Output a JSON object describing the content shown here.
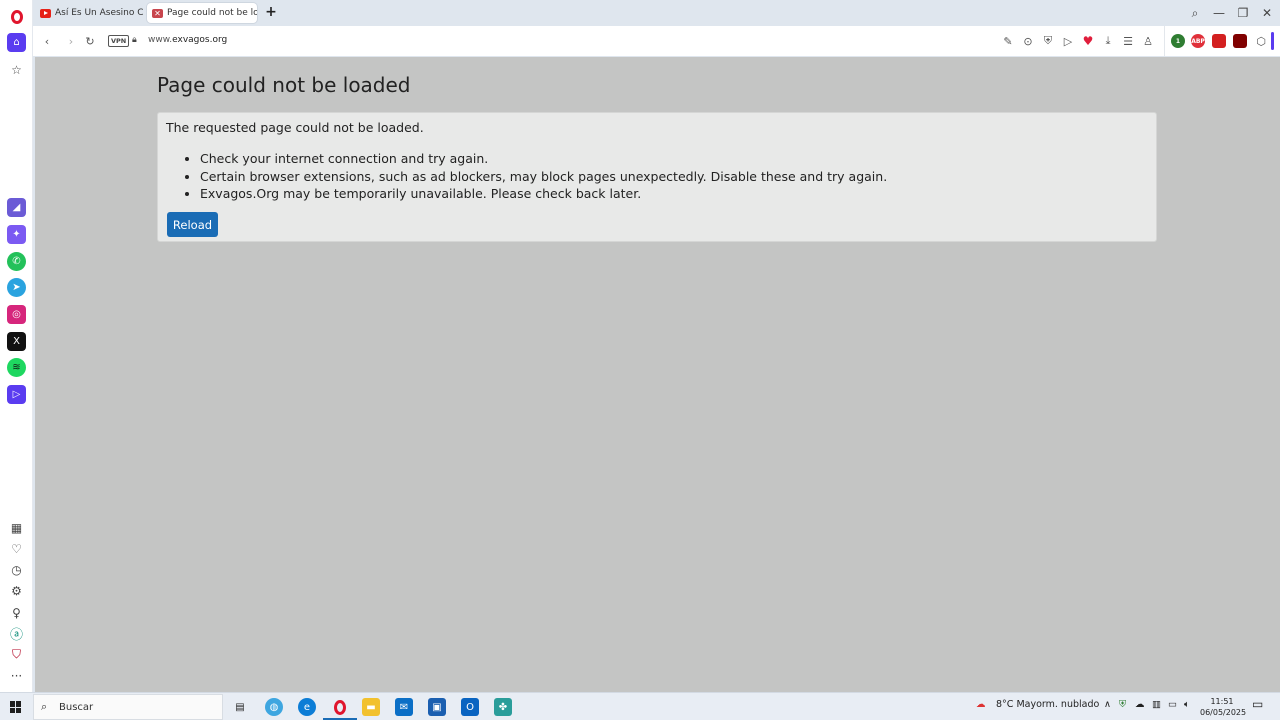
{
  "browser": {
    "tabs": [
      {
        "label": "Así Es Un Asesino Con Un",
        "favicon": "youtube-icon",
        "active": false
      },
      {
        "label": "Page could not be loaded",
        "favicon": "error-icon",
        "active": true
      }
    ],
    "new_tab_symbol": "+",
    "address": {
      "vpn_label": "VPN",
      "url_prefix": "www.",
      "url_domain": "exvagos.org"
    },
    "extensions": [
      {
        "name": "extension-badge-1",
        "badge": "1",
        "color": "#2f7d32"
      },
      {
        "name": "adblock-plus-extension",
        "badge": "ABP",
        "color": "#e0303a"
      },
      {
        "name": "extension-red",
        "badge": "",
        "color": "#d32020"
      },
      {
        "name": "ublock-origin-extension",
        "badge": "",
        "color": "#800000"
      }
    ]
  },
  "error_page": {
    "title": "Page could not be loaded",
    "message": "The requested page could not be loaded.",
    "bullets": [
      "Check your internet connection and try again.",
      "Certain browser extensions, such as ad blockers, may block pages unexpectedly. Disable these and try again.",
      "Exvagos.Org may be temporarily unavailable. Please check back later."
    ],
    "reload_label": "Reload"
  },
  "taskbar": {
    "search_placeholder": "Buscar",
    "weather": "8°C  Mayorm. nublado",
    "time": "11:51",
    "date": "06/05/2025"
  },
  "colors": {
    "accent": "#5a3cf0",
    "reload_button": "#1a6cb5",
    "opera_red": "#e0152d"
  }
}
